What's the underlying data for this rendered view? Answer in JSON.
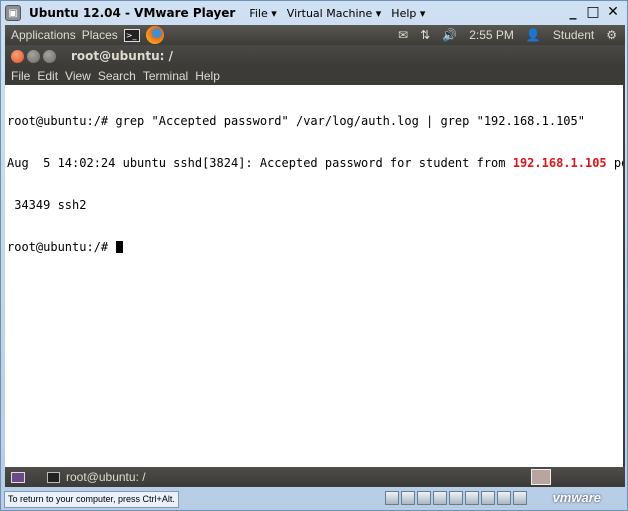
{
  "vmware": {
    "logo_icon": "vmware-player-icon",
    "title": "Ubuntu 12.04 - VMware Player",
    "menu": [
      "File ▾",
      "Virtual Machine ▾",
      "Help ▾"
    ],
    "controls": {
      "minimize": "_",
      "restore": "□",
      "close": "✕"
    },
    "status_hint": "To return to your computer, press Ctrl+Alt.",
    "brand": "vmware"
  },
  "ubuntu_panel": {
    "applications": "Applications",
    "places": "Places",
    "terminal_launcher_glyph": ">_",
    "time": "2:55 PM",
    "user_glyph": "👤",
    "user": "Student",
    "mail_glyph": "✉",
    "network_glyph": "⇅",
    "volume_glyph": "🔊",
    "settings_glyph": "⚙"
  },
  "terminal": {
    "window_title": "root@ubuntu: /",
    "menu": [
      "File",
      "Edit",
      "View",
      "Search",
      "Terminal",
      "Help"
    ],
    "lines": {
      "l1": "root@ubuntu:/# grep \"Accepted password\" /var/log/auth.log | grep \"192.168.1.105\"",
      "l2_pre": "Aug  5 14:02:24 ubuntu sshd[3824]: Accepted password for student from ",
      "l2_ip": "192.168.1.105",
      "l2_post": " port",
      "l3": " 34349 ssh2",
      "l4": "root@ubuntu:/# "
    },
    "accent_color": "#e3121a"
  },
  "taskbar": {
    "task_label": "root@ubuntu: /"
  }
}
